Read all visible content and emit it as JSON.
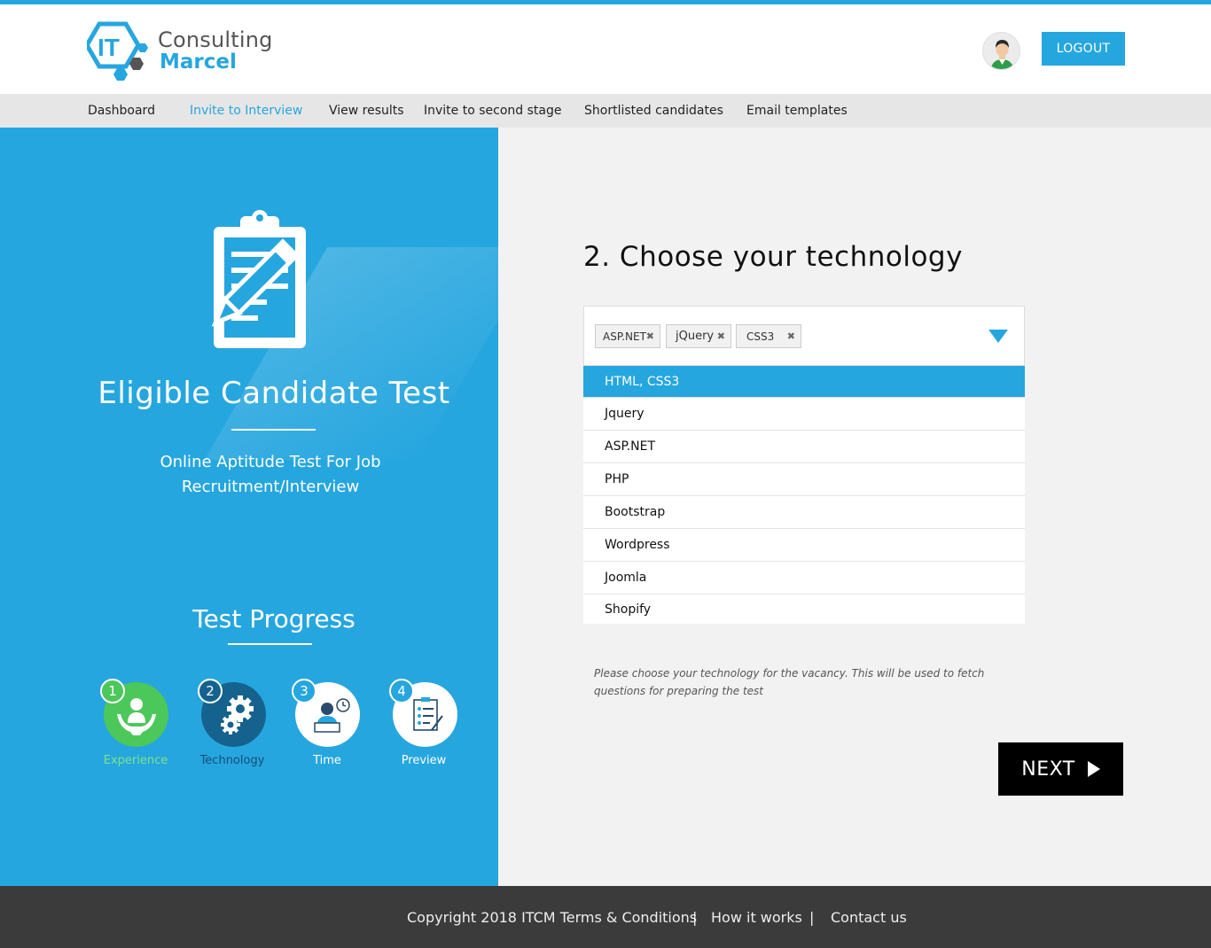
{
  "brand": {
    "logo_mark_text": "IT",
    "line1": "Consulting",
    "line2": "Marcel",
    "accent_color": "#26a6df"
  },
  "header": {
    "logout_label": "LOGOUT"
  },
  "nav": {
    "items": [
      {
        "label": "Dashboard",
        "active": false
      },
      {
        "label": "Invite to Interview",
        "active": true
      },
      {
        "label": "View results",
        "active": false
      },
      {
        "label": "Invite to second stage",
        "active": false
      },
      {
        "label": "Shortlisted candidates",
        "active": false
      },
      {
        "label": "Email templates",
        "active": false
      }
    ]
  },
  "hero": {
    "icon": "clipboard-pencil-icon",
    "title": "Eligible Candidate Test",
    "subtitle": "Online Aptitude Test For Job Recruitment/Interview"
  },
  "progress": {
    "title": "Test Progress",
    "steps": [
      {
        "number": "1",
        "label": "Experience",
        "icon": "hands-person-icon",
        "state": "done",
        "color": "#4cc75a",
        "label_color": "#7de28a"
      },
      {
        "number": "2",
        "label": "Technology",
        "icon": "gears-icon",
        "state": "current",
        "color": "#16628f",
        "label_color": "#164e73"
      },
      {
        "number": "3",
        "label": "Time",
        "icon": "person-laptop-clock-icon",
        "state": "pending",
        "color": "#ffffff",
        "label_color": "#ffffff"
      },
      {
        "number": "4",
        "label": "Preview",
        "icon": "checklist-icon",
        "state": "pending",
        "color": "#ffffff",
        "label_color": "#ffffff"
      }
    ]
  },
  "technology": {
    "title": "2. Choose your technology",
    "selected_tags": [
      "ASP.NET",
      "jQuery",
      "CSS3"
    ],
    "options": [
      {
        "label": "HTML, CSS3",
        "highlighted": true
      },
      {
        "label": "Jquery",
        "highlighted": false
      },
      {
        "label": "ASP.NET",
        "highlighted": false
      },
      {
        "label": "PHP",
        "highlighted": false
      },
      {
        "label": "Bootstrap",
        "highlighted": false
      },
      {
        "label": "Wordpress",
        "highlighted": false
      },
      {
        "label": "Joomla",
        "highlighted": false
      },
      {
        "label": "Shopify",
        "highlighted": false
      }
    ],
    "hint": "Please choose your technology for the vacancy. This will be used to fetch questions for preparing the test",
    "next_label": "NEXT"
  },
  "footer": {
    "copyright": "Copyright 2018 ITCM Terms & Conditions",
    "sep": "|",
    "how_it_works": "How it works",
    "contact": "Contact us"
  }
}
